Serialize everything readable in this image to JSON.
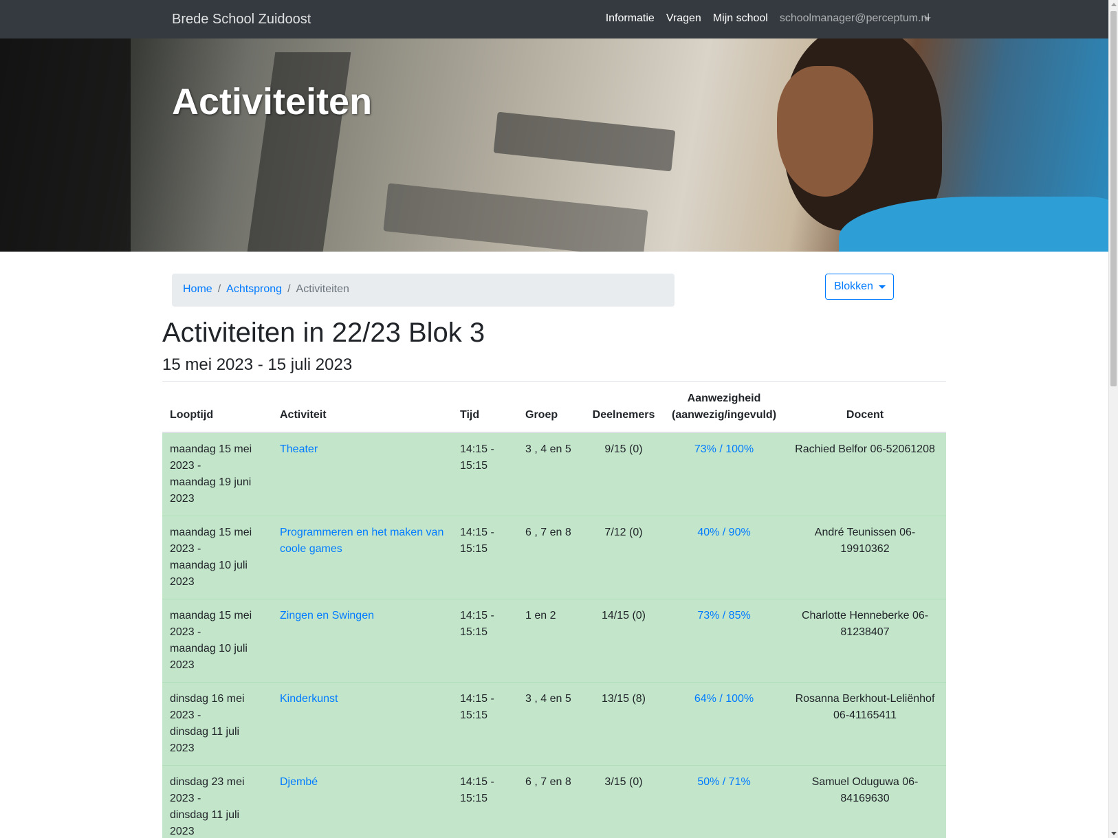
{
  "navbar": {
    "brand": "Brede School Zuidoost",
    "links": [
      "Informatie",
      "Vragen",
      "Mijn school"
    ],
    "user": "schoolmanager@perceptum.nl"
  },
  "hero": {
    "title": "Activiteiten"
  },
  "breadcrumb": {
    "home": "Home",
    "parent": "Achtsprong",
    "current": "Activiteiten",
    "separator": "/"
  },
  "blokken_button": "Blokken",
  "page": {
    "title": "Activiteiten in 22/23 Blok 3",
    "subtitle": "15 mei 2023 - 15 juli 2023"
  },
  "table": {
    "headers": {
      "looptijd": "Looptijd",
      "activiteit": "Activiteit",
      "tijd": "Tijd",
      "groep": "Groep",
      "deelnemers": "Deelnemers",
      "aanwezigheid_line1": "Aanwezigheid",
      "aanwezigheid_line2": "(aanwezig/ingevuld)",
      "docent": "Docent"
    },
    "rows": [
      {
        "looptijd_start": "maandag 15 mei 2023 -",
        "looptijd_end": "maandag 19 juni 2023",
        "activiteit": "Theater",
        "tijd": "14:15 - 15:15",
        "groep": "3 , 4 en 5",
        "deelnemers": "9/15 (0)",
        "aanwezigheid": "73% / 100%",
        "docent": "Rachied Belfor 06-52061208"
      },
      {
        "looptijd_start": "maandag 15 mei 2023 -",
        "looptijd_end": "maandag 10 juli 2023",
        "activiteit": "Programmeren en het maken van coole games",
        "tijd": "14:15 - 15:15",
        "groep": "6 , 7 en 8",
        "deelnemers": "7/12 (0)",
        "aanwezigheid": "40% / 90%",
        "docent": "André Teunissen 06-19910362"
      },
      {
        "looptijd_start": "maandag 15 mei 2023 -",
        "looptijd_end": "maandag 10 juli 2023",
        "activiteit": "Zingen en Swingen",
        "tijd": "14:15 - 15:15",
        "groep": "1 en 2",
        "deelnemers": "14/15 (0)",
        "aanwezigheid": "73% / 85%",
        "docent": "Charlotte Henneberke 06-81238407"
      },
      {
        "looptijd_start": "dinsdag 16 mei 2023 -",
        "looptijd_end": "dinsdag 11 juli 2023",
        "activiteit": "Kinderkunst",
        "tijd": "14:15 - 15:15",
        "groep": "3 , 4 en 5",
        "deelnemers": "13/15 (8)",
        "aanwezigheid": "64% / 100%",
        "docent": "Rosanna Berkhout-Leliënhof 06-41165411"
      },
      {
        "looptijd_start": "dinsdag 23 mei 2023 -",
        "looptijd_end": "dinsdag 11 juli 2023",
        "activiteit": "Djembé",
        "tijd": "14:15 - 15:15",
        "groep": "6 , 7 en 8",
        "deelnemers": "3/15 (0)",
        "aanwezigheid": "50% / 71%",
        "docent": "Samuel Oduguwa 06-84169630"
      }
    ]
  }
}
